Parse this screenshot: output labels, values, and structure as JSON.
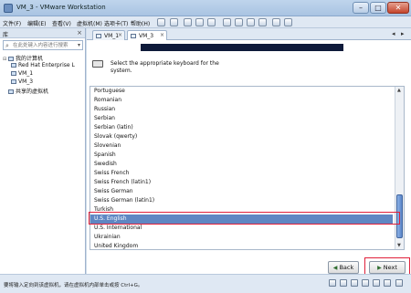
{
  "window": {
    "title": "VM_3 - VMware Workstation",
    "min": "–",
    "max": "□",
    "close": "✕"
  },
  "menu": [
    "文件(F)",
    "编辑(E)",
    "查看(V)",
    "虚拟机(M)",
    "选项卡(T)",
    "帮助(H)"
  ],
  "library": {
    "title": "库",
    "close": "×",
    "search_placeholder": "在此处键入内容进行搜索",
    "tree": {
      "my_computer": "我的计算机",
      "vms": [
        "Red Hat Enterprise L",
        "VM_1",
        "VM_3"
      ],
      "shared": "共享的虚拟机"
    }
  },
  "tabs": [
    {
      "label": "VM_1",
      "close": "×"
    },
    {
      "label": "VM_3",
      "close": "×"
    }
  ],
  "installer": {
    "instruction": "Select the appropriate keyboard for the system.",
    "keyboards": [
      "Portuguese",
      "Romanian",
      "Russian",
      "Serbian",
      "Serbian (latin)",
      "Slovak (qwerty)",
      "Slovenian",
      "Spanish",
      "Swedish",
      "Swiss French",
      "Swiss French (latin1)",
      "Swiss German",
      "Swiss German (latin1)",
      "Turkish",
      "U.S. English",
      "U.S. International",
      "Ukrainian",
      "United Kingdom"
    ],
    "selected": "U.S. English",
    "back_label": "Back",
    "next_label": "Next",
    "back_arrow": "◀",
    "next_arrow": "▶"
  },
  "status": {
    "text": "要将输入定向到该虚拟机，请在虚拟机内部单击或按 Ctrl+G。"
  }
}
